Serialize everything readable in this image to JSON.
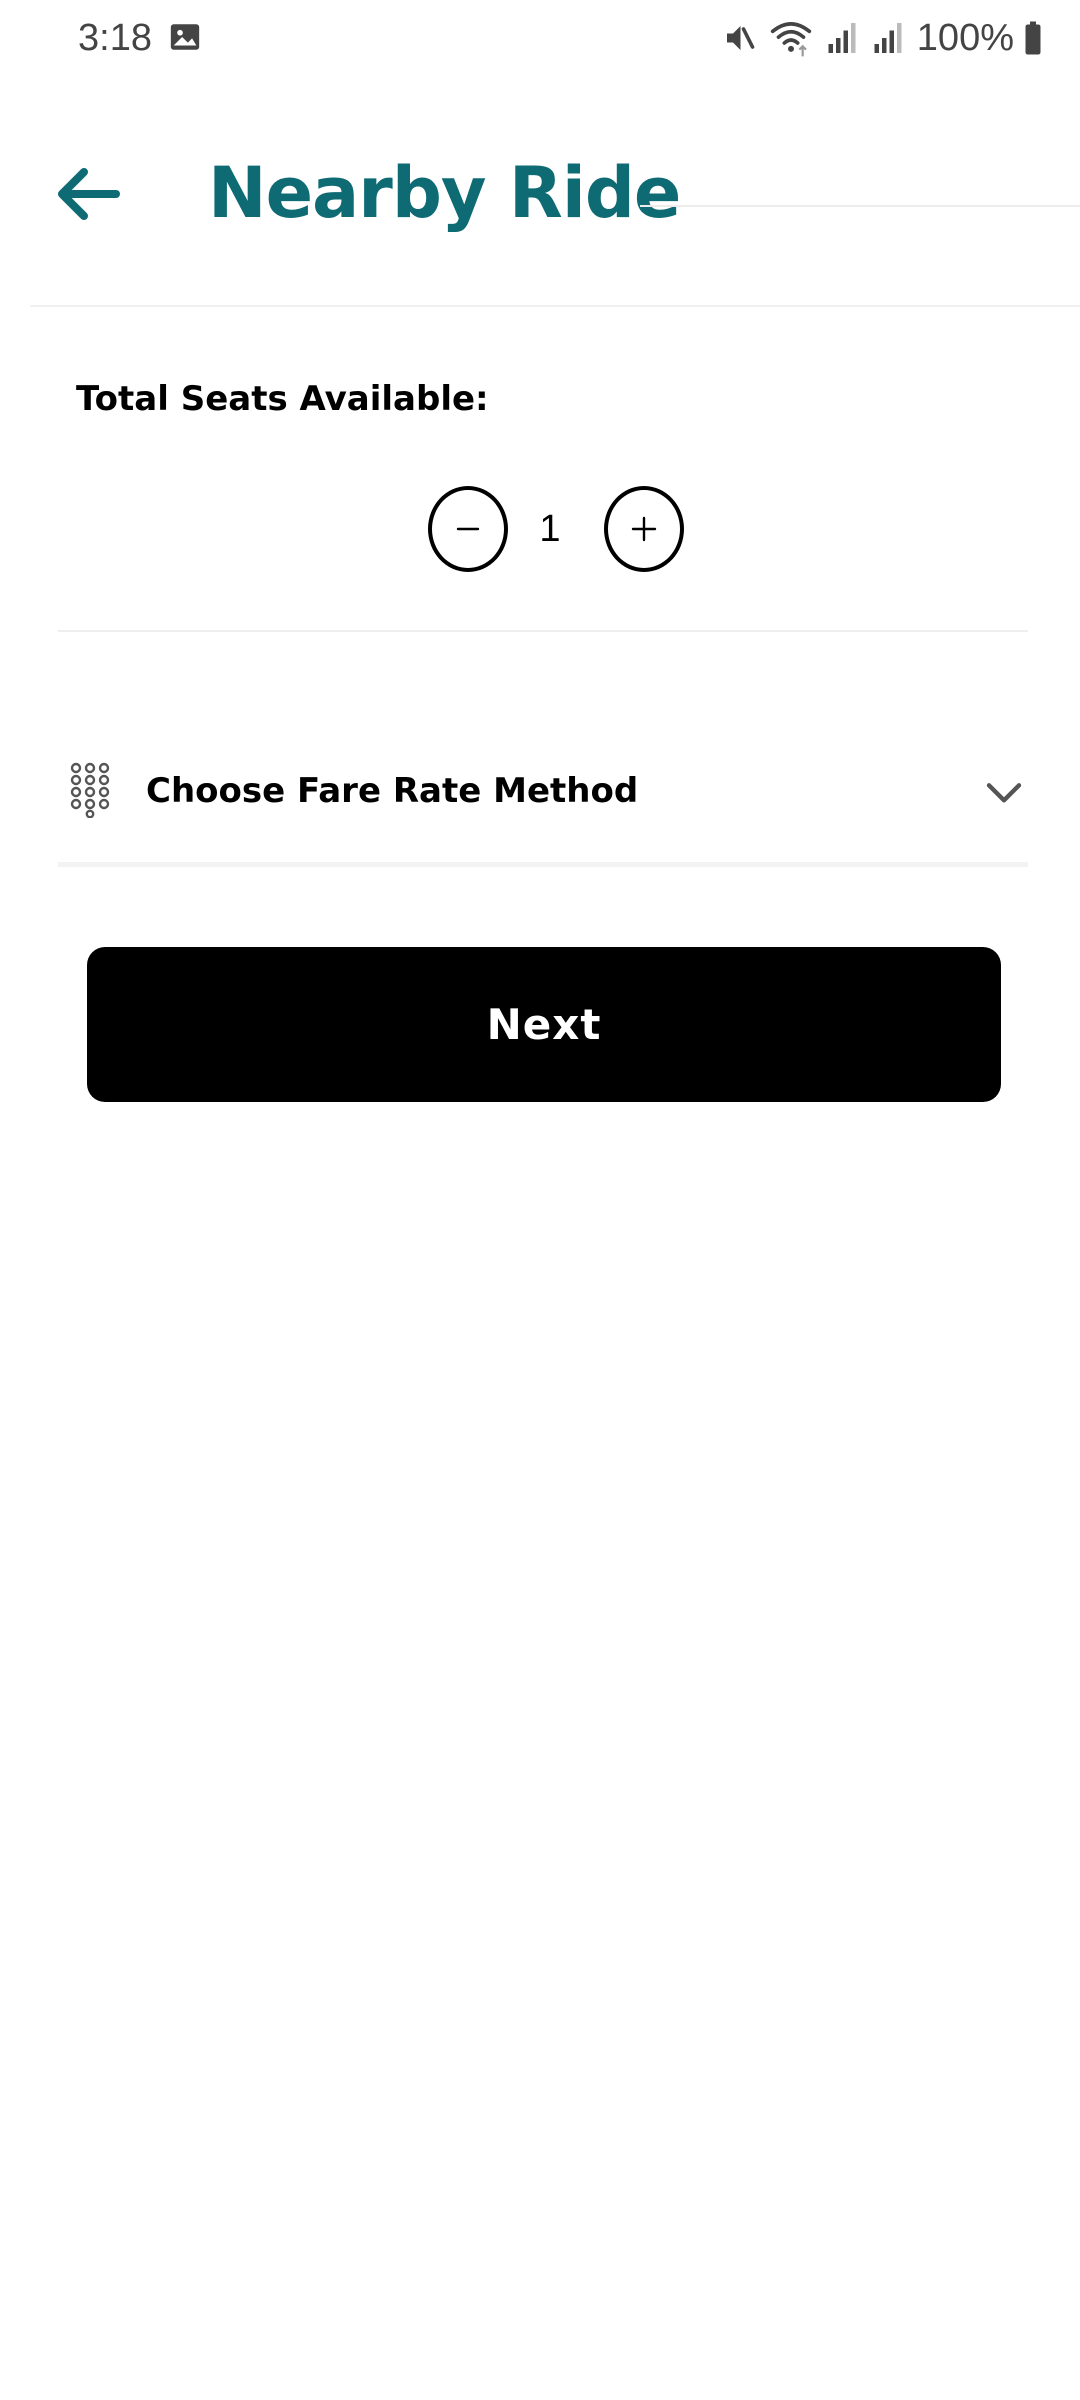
{
  "status_bar": {
    "time": "3:18",
    "battery_text": "100%",
    "icons": [
      "gallery-icon",
      "mute-icon",
      "wifi-icon",
      "signal-icon",
      "signal-icon",
      "battery-icon"
    ]
  },
  "header": {
    "title": "Nearby Ride",
    "back_icon": "arrow-left-icon"
  },
  "seats": {
    "label": "Total Seats Available:",
    "value": "1",
    "decrement_icon": "minus-icon",
    "increment_icon": "plus-icon"
  },
  "fare": {
    "label": "Choose Fare Rate Method",
    "icon": "keypad-icon",
    "chevron_icon": "chevron-down-icon"
  },
  "actions": {
    "next_label": "Next"
  },
  "colors": {
    "title": "#0e6b74",
    "button_bg": "#000000",
    "button_text": "#ffffff"
  }
}
